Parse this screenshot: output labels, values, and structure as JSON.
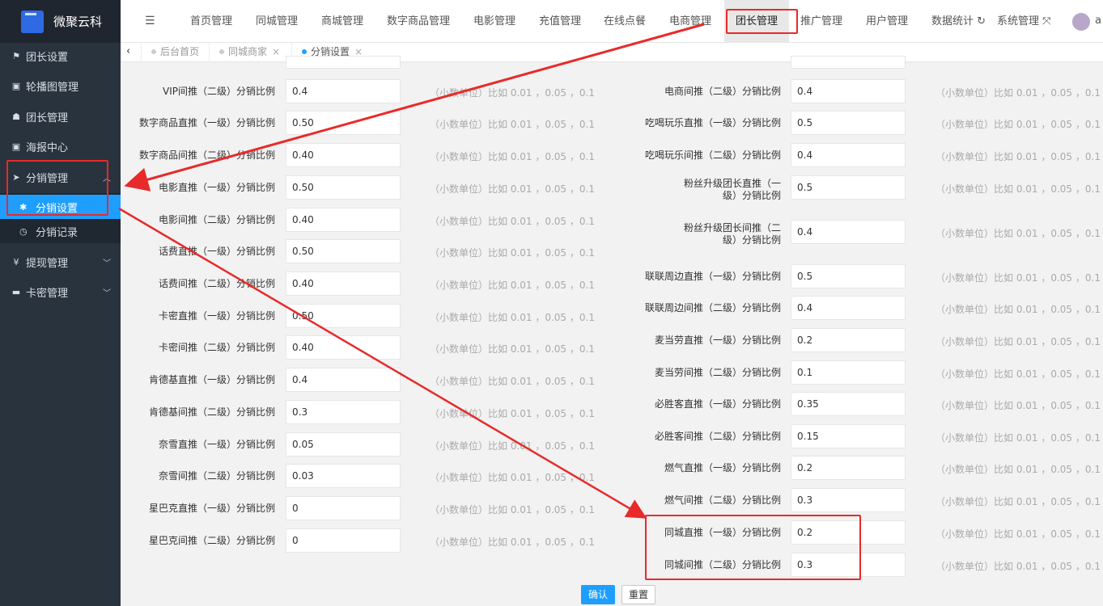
{
  "app": {
    "title": "微聚云科"
  },
  "sidebar": {
    "items": [
      {
        "icon": "flag-icon",
        "label": "团长设置"
      },
      {
        "icon": "image-icon",
        "label": "轮播图管理"
      },
      {
        "icon": "users-icon",
        "label": "团长管理"
      },
      {
        "icon": "image-icon",
        "label": "海报中心"
      },
      {
        "icon": "send-icon",
        "label": "分销管理",
        "expanded": true
      },
      {
        "icon": "yen-icon",
        "label": "提现管理"
      },
      {
        "icon": "card-icon",
        "label": "卡密管理"
      }
    ],
    "subitems": [
      {
        "icon": "gear-icon",
        "label": "分销设置",
        "active": true
      },
      {
        "icon": "clock-icon",
        "label": "分销记录"
      }
    ]
  },
  "topnav": {
    "items": [
      "首页管理",
      "同城管理",
      "商城管理",
      "数字商品管理",
      "电影管理",
      "充值管理",
      "在线点餐",
      "电商管理",
      "团长管理",
      "推广管理",
      "用户管理",
      "数据统计",
      "系统管理"
    ],
    "active": "团长管理",
    "user_initial": "a"
  },
  "tabs": [
    {
      "label": "后台首页",
      "closable": false
    },
    {
      "label": "同城商家",
      "closable": true
    },
    {
      "label": "分销设置",
      "closable": true,
      "active": true
    }
  ],
  "form": {
    "hint": "（小数单位）比如 0.01 ，0.05 ，0.1",
    "left": [
      {
        "label": "VIP间推（二级）分销比例",
        "value": "0.4"
      },
      {
        "label": "数字商品直推（一级）分销比例",
        "value": "0.50"
      },
      {
        "label": "数字商品间推（二级）分销比例",
        "value": "0.40"
      },
      {
        "label": "电影直推（一级）分销比例",
        "value": "0.50"
      },
      {
        "label": "电影间推（二级）分销比例",
        "value": "0.40"
      },
      {
        "label": "话费直推（一级）分销比例",
        "value": "0.50"
      },
      {
        "label": "话费间推（二级）分销比例",
        "value": "0.40"
      },
      {
        "label": "卡密直推（一级）分销比例",
        "value": "0.50"
      },
      {
        "label": "卡密间推（二级）分销比例",
        "value": "0.40"
      },
      {
        "label": "肯德基直推（一级）分销比例",
        "value": "0.4"
      },
      {
        "label": "肯德基间推（二级）分销比例",
        "value": "0.3"
      },
      {
        "label": "奈雪直推（一级）分销比例",
        "value": "0.05"
      },
      {
        "label": "奈雪间推（二级）分销比例",
        "value": "0.03"
      },
      {
        "label": "星巴克直推（一级）分销比例",
        "value": "0"
      },
      {
        "label": "星巴克间推（二级）分销比例",
        "value": "0"
      }
    ],
    "right": [
      {
        "label": "电商间推（二级）分销比例",
        "value": "0.4"
      },
      {
        "label": "吃喝玩乐直推（一级）分销比例",
        "value": "0.5"
      },
      {
        "label": "吃喝玩乐间推（二级）分销比例",
        "value": "0.4"
      },
      {
        "label": "粉丝升级团长直推（一级）分销比例",
        "value": "0.5"
      },
      {
        "label": "粉丝升级团长间推（二级）分销比例",
        "value": "0.4"
      },
      {
        "label": "联联周边直推（一级）分销比例",
        "value": "0.5"
      },
      {
        "label": "联联周边间推（二级）分销比例",
        "value": "0.4"
      },
      {
        "label": "麦当劳直推（一级）分销比例",
        "value": "0.2"
      },
      {
        "label": "麦当劳间推（二级）分销比例",
        "value": "0.1"
      },
      {
        "label": "必胜客直推（一级）分销比例",
        "value": "0.35"
      },
      {
        "label": "必胜客间推（二级）分销比例",
        "value": "0.15"
      },
      {
        "label": "燃气直推（一级）分销比例",
        "value": "0.2"
      },
      {
        "label": "燃气间推（二级）分销比例",
        "value": "0.3"
      },
      {
        "label": "同城直推（一级）分销比例",
        "value": "0.2"
      },
      {
        "label": "同城间推（二级）分销比例",
        "value": "0.3"
      }
    ],
    "submit_label": "确认",
    "reset_label": "重置"
  },
  "colors": {
    "accent": "#1e9fff",
    "sidebar": "#28333e",
    "annotation": "#e82a2a"
  }
}
